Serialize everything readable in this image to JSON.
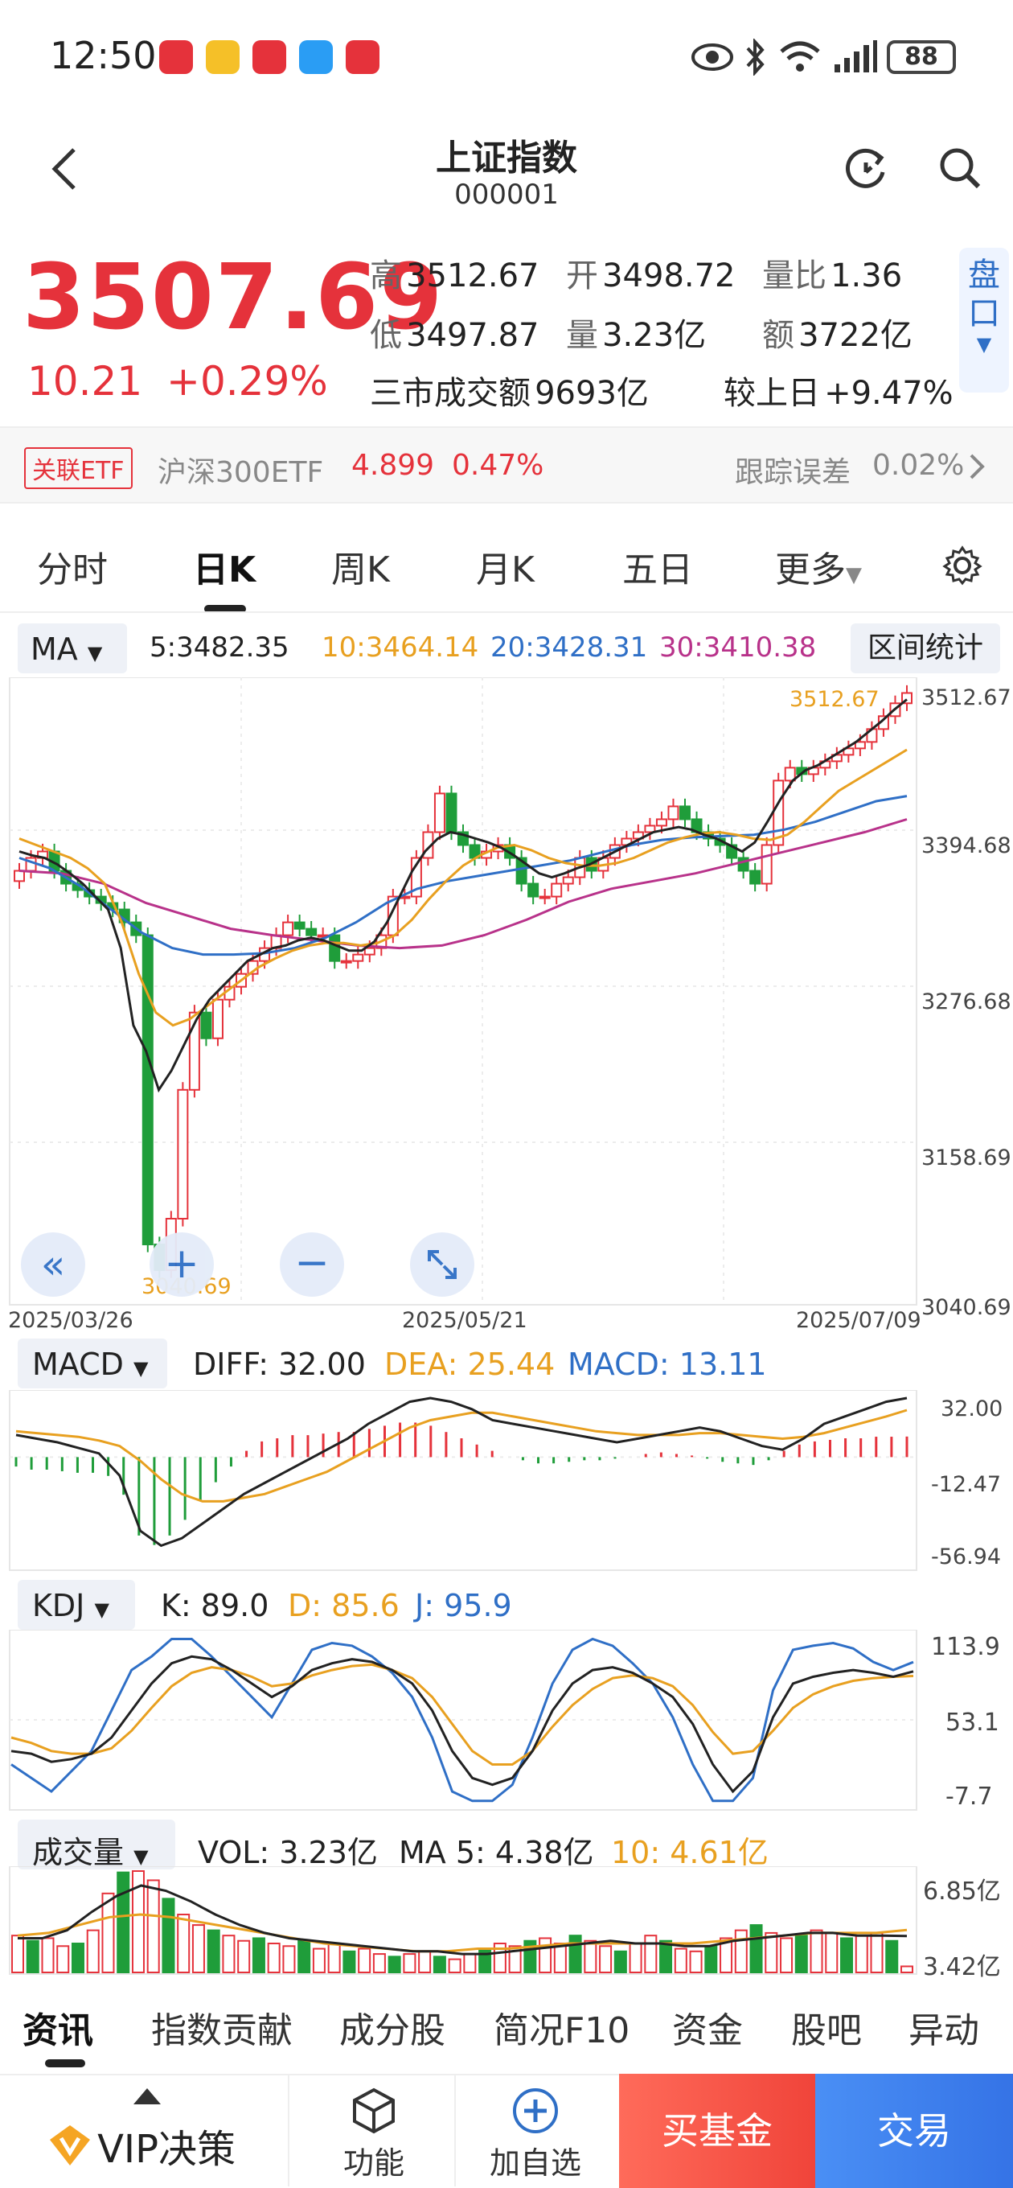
{
  "status": {
    "time": "12:50",
    "battery": "88"
  },
  "header": {
    "title": "上证指数",
    "code": "000001"
  },
  "quote": {
    "price": "3507.69",
    "change": "10.21",
    "change_pct": "+0.29%",
    "high_label": "高",
    "high": "3512.67",
    "open_label": "开",
    "open": "3498.72",
    "ratio_label": "量比",
    "ratio": "1.36",
    "low_label": "低",
    "low": "3497.87",
    "vol_label": "量",
    "vol": "3.23亿",
    "amt_label": "额",
    "amt": "3722亿",
    "market_label": "三市成交额",
    "market": "9693亿",
    "prev_label": "较上日",
    "prev": "+9.47%",
    "pankou": "盘口"
  },
  "etf": {
    "tag": "关联ETF",
    "name": "沪深300ETF",
    "price": "4.899",
    "pct": "0.47%",
    "track_label": "跟踪误差",
    "track": "0.02%"
  },
  "tabs": [
    "分时",
    "日K",
    "周K",
    "月K",
    "五日",
    "更多"
  ],
  "ma": {
    "label": "MA",
    "ma5": "5:3482.35",
    "ma10": "10:3464.14",
    "ma20": "20:3428.31",
    "ma30": "30:3410.38",
    "range": "区间统计"
  },
  "macd": {
    "label": "MACD",
    "diff": "DIFF: 32.00",
    "dea": "DEA: 25.44",
    "macd": "MACD: 13.11"
  },
  "kdj": {
    "label": "KDJ",
    "k": "K: 89.0",
    "d": "D: 85.6",
    "j": "J: 95.9"
  },
  "vol": {
    "label": "成交量",
    "vol": "VOL:  3.23亿",
    "ma5": "MA 5:  4.38亿",
    "ma10": "10:  4.61亿"
  },
  "bottom_tabs": [
    "资讯",
    "指数贡献",
    "成分股",
    "简况F10",
    "资金",
    "股吧",
    "异动"
  ],
  "bottom_bar": {
    "vip": "VIP决策",
    "func": "功能",
    "add": "加自选",
    "buy_fund": "买基金",
    "trade": "交易"
  },
  "colors": {
    "up": "#e5323b",
    "down": "#1f9d3a",
    "ma10": "#e8a020",
    "ma20": "#2f6fc6",
    "ma30": "#b8328a"
  },
  "chart_data": [
    {
      "type": "candlestick",
      "x_labels": [
        "2025/03/26",
        "2025/05/21",
        "2025/07/09"
      ],
      "y_ticks": [
        "3512.67",
        "3394.68",
        "3276.68",
        "3158.69",
        "3040.69"
      ],
      "ylim": [
        3040.69,
        3512.67
      ],
      "annotations": {
        "max": "3512.67",
        "min": "3040.69"
      },
      "close": [
        3370,
        3380,
        3385,
        3370,
        3360,
        3355,
        3350,
        3345,
        3340,
        3330,
        3320,
        3080,
        3060,
        3100,
        3200,
        3260,
        3240,
        3270,
        3280,
        3290,
        3300,
        3310,
        3320,
        3330,
        3325,
        3320,
        3320,
        3300,
        3300,
        3305,
        3310,
        3320,
        3350,
        3350,
        3380,
        3400,
        3430,
        3400,
        3390,
        3380,
        3385,
        3390,
        3380,
        3360,
        3350,
        3350,
        3360,
        3365,
        3380,
        3370,
        3380,
        3390,
        3395,
        3400,
        3405,
        3410,
        3420,
        3410,
        3400,
        3395,
        3390,
        3380,
        3370,
        3360,
        3390,
        3440,
        3450,
        3445,
        3450,
        3455,
        3460,
        3465,
        3470,
        3480,
        3490,
        3500,
        3508
      ],
      "ma5": [
        3385,
        3382,
        3380,
        3375,
        3368,
        3360,
        3350,
        3340,
        3310,
        3250,
        3230,
        3200,
        3215,
        3235,
        3255,
        3270,
        3280,
        3290,
        3300,
        3305,
        3310,
        3312,
        3316,
        3318,
        3316,
        3312,
        3308,
        3308,
        3315,
        3330,
        3350,
        3370,
        3385,
        3395,
        3400,
        3398,
        3395,
        3392,
        3388,
        3382,
        3375,
        3368,
        3365,
        3368,
        3372,
        3375,
        3380,
        3385,
        3390,
        3395,
        3400,
        3402,
        3404,
        3402,
        3398,
        3395,
        3390,
        3385,
        3392,
        3408,
        3425,
        3440,
        3448,
        3452,
        3458,
        3464,
        3470,
        3478,
        3486,
        3495,
        3503
      ],
      "ma10": [
        3395,
        3390,
        3385,
        3380,
        3372,
        3360,
        3330,
        3290,
        3260,
        3250,
        3255,
        3265,
        3275,
        3285,
        3295,
        3302,
        3308,
        3312,
        3314,
        3314,
        3312,
        3314,
        3320,
        3332,
        3348,
        3362,
        3374,
        3382,
        3388,
        3390,
        3386,
        3380,
        3376,
        3374,
        3374,
        3376,
        3380,
        3386,
        3392,
        3396,
        3399,
        3400,
        3398,
        3395,
        3394,
        3398,
        3408,
        3420,
        3432,
        3440,
        3448,
        3456,
        3464
      ],
      "ma20": [
        3380,
        3372,
        3358,
        3340,
        3322,
        3310,
        3305,
        3305,
        3306,
        3310,
        3318,
        3330,
        3345,
        3356,
        3362,
        3366,
        3370,
        3374,
        3378,
        3384,
        3390,
        3394,
        3396,
        3397,
        3398,
        3402,
        3408,
        3416,
        3424,
        3428
      ],
      "ma30": [
        3370,
        3368,
        3360,
        3345,
        3335,
        3325,
        3320,
        3316,
        3312,
        3310,
        3312,
        3320,
        3332,
        3346,
        3356,
        3362,
        3368,
        3376,
        3384,
        3392,
        3400,
        3410
      ]
    },
    {
      "type": "macd",
      "y_ticks": [
        "32.00",
        "-12.47",
        "-56.94"
      ],
      "ylim": [
        -56.94,
        32.0
      ],
      "diff": [
        12,
        10,
        8,
        5,
        2,
        -10,
        -40,
        -48,
        -44,
        -36,
        -28,
        -20,
        -14,
        -8,
        -2,
        4,
        10,
        18,
        24,
        30,
        32,
        30,
        26,
        20,
        18,
        16,
        14,
        12,
        10,
        8,
        10,
        12,
        14,
        16,
        14,
        10,
        6,
        4,
        10,
        18,
        22,
        26,
        30,
        32
      ],
      "dea": [
        14,
        13,
        12,
        11,
        9,
        6,
        -2,
        -12,
        -20,
        -24,
        -24,
        -22,
        -20,
        -16,
        -12,
        -8,
        -2,
        4,
        10,
        16,
        20,
        22,
        24,
        24,
        22,
        20,
        18,
        16,
        14,
        13,
        12,
        12,
        12,
        13,
        13,
        12,
        11,
        10,
        11,
        13,
        16,
        19,
        22,
        25.44
      ],
      "histogram": [
        -6,
        -8,
        -8,
        -9,
        -10,
        -10,
        -12,
        -24,
        -50,
        -56,
        -50,
        -40,
        -28,
        -16,
        -6,
        4,
        10,
        12,
        14,
        14,
        15,
        16,
        16,
        18,
        20,
        22,
        22,
        20,
        16,
        12,
        8,
        4,
        0,
        -2,
        -4,
        -4,
        -3,
        -2,
        -2,
        -1,
        0,
        2,
        3,
        2,
        1,
        -1,
        -3,
        -4,
        -5,
        -2,
        4,
        8,
        10,
        11,
        12,
        12,
        13,
        13,
        13.11
      ]
    },
    {
      "type": "kdj",
      "y_ticks": [
        "113.9",
        "53.1",
        "-7.7"
      ],
      "ylim": [
        -7.7,
        113.9
      ],
      "k": [
        30,
        28,
        22,
        24,
        28,
        40,
        60,
        80,
        95,
        100,
        98,
        90,
        80,
        70,
        78,
        90,
        95,
        98,
        96,
        90,
        80,
        60,
        30,
        10,
        5,
        10,
        30,
        60,
        80,
        90,
        92,
        88,
        80,
        70,
        50,
        20,
        0,
        15,
        55,
        80,
        85,
        88,
        90,
        88,
        85,
        89
      ],
      "d": [
        40,
        36,
        30,
        28,
        28,
        32,
        45,
        62,
        78,
        88,
        92,
        90,
        85,
        78,
        80,
        86,
        90,
        93,
        94,
        90,
        84,
        70,
        50,
        30,
        20,
        20,
        30,
        48,
        64,
        76,
        84,
        86,
        84,
        78,
        64,
        44,
        28,
        30,
        45,
        62,
        72,
        78,
        82,
        84,
        85,
        85.6
      ],
      "j": [
        20,
        10,
        0,
        15,
        30,
        60,
        90,
        100,
        113,
        113,
        100,
        85,
        70,
        55,
        80,
        105,
        110,
        108,
        100,
        88,
        70,
        40,
        0,
        -7,
        -7,
        5,
        40,
        80,
        105,
        113,
        108,
        95,
        80,
        55,
        20,
        -7,
        -7,
        10,
        75,
        105,
        108,
        110,
        106,
        96,
        90,
        95.9
      ]
    },
    {
      "type": "bar",
      "y_ticks": [
        "6.85亿",
        "3.42亿"
      ],
      "ylim": [
        3.0,
        6.85
      ],
      "volume": [
        4.4,
        4.2,
        4.3,
        4.0,
        4.1,
        4.6,
        6.0,
        6.8,
        6.85,
        6.5,
        5.8,
        5.2,
        4.8,
        4.6,
        4.4,
        4.2,
        4.3,
        4.1,
        4.0,
        4.2,
        3.9,
        4.1,
        3.8,
        3.9,
        3.7,
        3.6,
        3.7,
        3.8,
        3.6,
        3.5,
        3.7,
        3.9,
        4.1,
        4.0,
        4.2,
        4.3,
        4.1,
        4.4,
        4.2,
        4.0,
        3.8,
        4.1,
        4.4,
        4.2,
        3.9,
        3.8,
        4.0,
        4.3,
        4.6,
        4.8,
        4.5,
        4.3,
        4.4,
        4.6,
        4.5,
        4.3,
        4.4,
        4.5,
        4.2,
        3.23
      ],
      "ma5": [
        4.3,
        4.3,
        4.6,
        5.3,
        5.9,
        6.3,
        6.1,
        5.7,
        5.2,
        4.8,
        4.5,
        4.3,
        4.2,
        4.1,
        4.0,
        3.9,
        3.8,
        3.8,
        3.7,
        3.7,
        3.8,
        3.9,
        4.0,
        4.1,
        4.2,
        4.1,
        4.1,
        4.0,
        4.0,
        4.2,
        4.3,
        4.4,
        4.5,
        4.5,
        4.4,
        4.4,
        4.38
      ],
      "ma10": [
        4.4,
        4.5,
        4.8,
        5.1,
        5.2,
        5.1,
        4.9,
        4.7,
        4.5,
        4.3,
        4.1,
        4.0,
        3.9,
        3.8,
        3.8,
        3.9,
        3.9,
        4.0,
        4.1,
        4.1,
        4.1,
        4.1,
        4.1,
        4.2,
        4.3,
        4.4,
        4.5,
        4.5,
        4.5,
        4.61
      ]
    }
  ]
}
